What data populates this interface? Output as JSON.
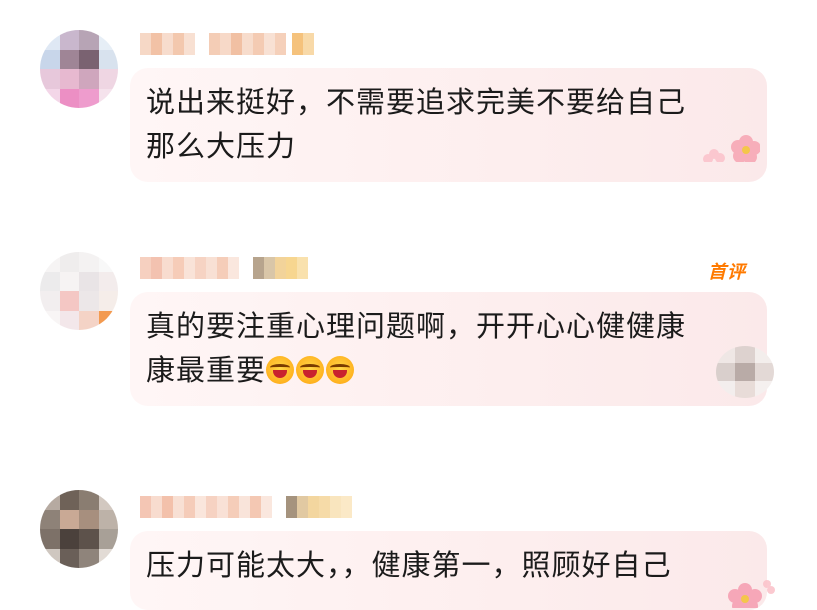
{
  "comments": [
    {
      "text": "说出来挺好，不需要追求完美不要给自己那么大压力",
      "badge": ""
    },
    {
      "text": "真的要注重心理问题啊，开开心心健健康康最重要",
      "emoji_count": 3,
      "badge": "首评"
    },
    {
      "text": "压力可能太大，，健康第一，照顾好自己",
      "badge": ""
    }
  ],
  "colors": {
    "bubble": "#fdeeee",
    "badge": "#ff7a00",
    "text": "#1b1b1b"
  },
  "icons": [
    "plum-blossom-icon",
    "laughing-emoji-icon"
  ]
}
